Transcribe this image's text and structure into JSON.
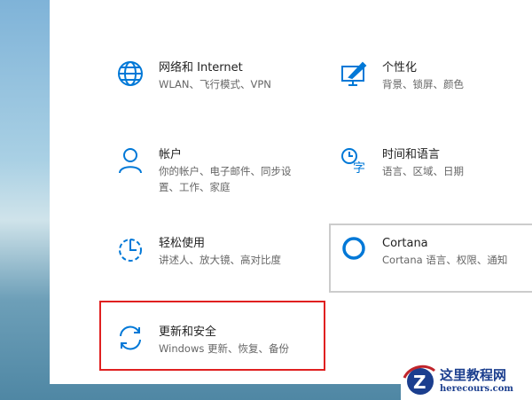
{
  "tiles": [
    {
      "title": "网络和 Internet",
      "subtitle": "WLAN、飞行模式、VPN",
      "icon": "globe-icon"
    },
    {
      "title": "个性化",
      "subtitle": "背景、锁屏、颜色",
      "icon": "personalization-icon"
    },
    {
      "title": "帐户",
      "subtitle": "你的帐户、电子邮件、同步设置、工作、家庭",
      "icon": "person-icon"
    },
    {
      "title": "时间和语言",
      "subtitle": "语言、区域、日期",
      "icon": "time-language-icon"
    },
    {
      "title": "轻松使用",
      "subtitle": "讲述人、放大镜、高对比度",
      "icon": "ease-of-access-icon"
    },
    {
      "title": "Cortana",
      "subtitle": "Cortana 语言、权限、通知",
      "icon": "cortana-icon"
    },
    {
      "title": "更新和安全",
      "subtitle": "Windows 更新、恢复、备份",
      "icon": "update-icon"
    }
  ],
  "watermark": {
    "name": "这里教程网",
    "url": "herecours.com"
  },
  "accent": "#0078d7"
}
